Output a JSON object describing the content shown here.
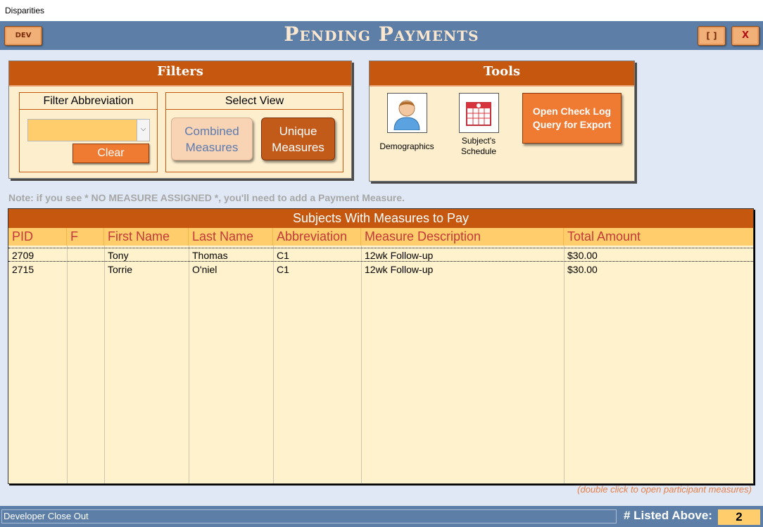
{
  "window": {
    "title": "Disparities"
  },
  "header": {
    "dev_label": "DEV",
    "title": "Pending Payments",
    "max_label": "[ ]",
    "close_label": "X",
    "bar_color": "#5d7fa7"
  },
  "filters": {
    "title": "Filters",
    "abbr_title": "Filter Abbreviation",
    "abbr_value": "",
    "clear_label": "Clear",
    "view_title": "Select View",
    "combined_label": "Combined Measures",
    "unique_label": "Unique Measures"
  },
  "tools": {
    "title": "Tools",
    "demographics_label": "Demographics",
    "demographics_icon": "person-icon",
    "schedule_label": "Subject's Schedule",
    "schedule_icon": "calendar-icon",
    "export_label": "Open Check Log Query for Export"
  },
  "note": "Note: if you see * NO MEASURE ASSIGNED *, you'll need to add a Payment Measure.",
  "grid": {
    "title": "Subjects With Measures to Pay",
    "columns": [
      "PID",
      "F",
      "First Name",
      "Last Name",
      "Abbreviation",
      "Measure Description",
      "Total Amount"
    ],
    "rows": [
      [
        "2709",
        "",
        "Tony",
        "Thomas",
        "C1",
        "12wk Follow-up",
        "$30.00"
      ],
      [
        "2715",
        "",
        "Torrie",
        "O'niel",
        "C1",
        "12wk Follow-up",
        "$30.00"
      ]
    ]
  },
  "hint": "(double click to open participant measures)",
  "status": {
    "text": "Developer Close Out",
    "listed_label": "# Listed Above:",
    "listed_count": "2"
  },
  "colors": {
    "accent": "#c5570f",
    "panel": "#fdefce",
    "grid_bg": "#fff2cc",
    "header_row": "#ffcd6c"
  }
}
